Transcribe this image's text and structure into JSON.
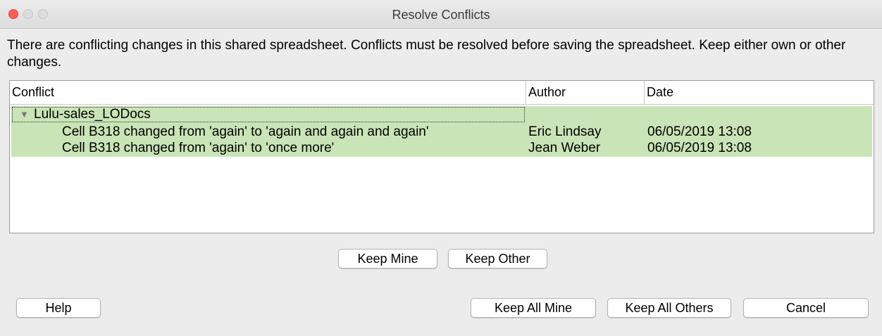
{
  "window": {
    "title": "Resolve Conflicts"
  },
  "message": "There are conflicting changes in this shared spreadsheet. Conflicts must be resolved before saving the spreadsheet. Keep either own or other changes.",
  "table": {
    "columns": [
      "Conflict",
      "Author",
      "Date"
    ],
    "group": {
      "label": "Lulu-sales_LODocs",
      "expanded": true
    },
    "rows": [
      {
        "conflict": "Cell B318 changed from 'again' to 'again and again and again'",
        "author": "Eric Lindsay",
        "date": "06/05/2019 13:08"
      },
      {
        "conflict": "Cell B318 changed from 'again' to 'once more'",
        "author": "Jean Weber",
        "date": "06/05/2019 13:08"
      }
    ]
  },
  "buttons": {
    "keep_mine": "Keep Mine",
    "keep_other": "Keep Other",
    "help": "Help",
    "keep_all_mine": "Keep All Mine",
    "keep_all_others": "Keep All Others",
    "cancel": "Cancel"
  },
  "colors": {
    "selection": "#c9e4b6",
    "close": "#fc5f57"
  },
  "icons": {
    "expand": "triangle-down-icon"
  }
}
